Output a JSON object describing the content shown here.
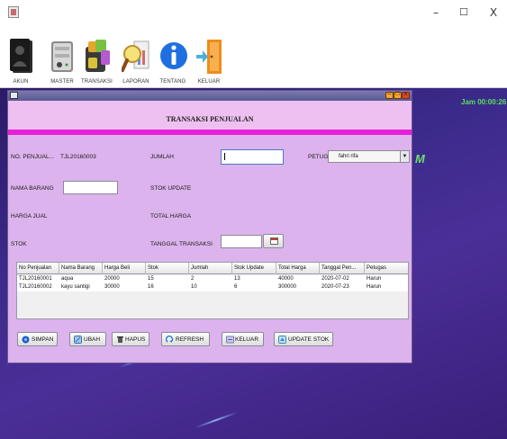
{
  "window": {
    "min_glyph": "–",
    "max_glyph": "☐",
    "close_glyph": "X"
  },
  "toolbar": [
    {
      "label": "AKUN",
      "icon": "user-card-icon"
    },
    {
      "label": "MASTER",
      "icon": "server-icon"
    },
    {
      "label": "TRANSAKSI",
      "icon": "transaction-icon"
    },
    {
      "label": "LAPORAN",
      "icon": "magnifier-report-icon"
    },
    {
      "label": "TENTANG",
      "icon": "info-icon"
    },
    {
      "label": "KELUAR",
      "icon": "exit-door-icon"
    }
  ],
  "desktop": {
    "clock": "Jam 00:00:26",
    "bg_letter": "M"
  },
  "form": {
    "title": "TRANSAKSI PENJUALAN",
    "no_penjualan_label": "NO. PENJUAL...",
    "no_penjualan_value": "TJL20160003",
    "jumlah_label": "JUMLAH",
    "jumlah_value": "",
    "petugas_label": "PETUGAS",
    "petugas_value": "fahri rifa",
    "nama_barang_label": "NAMA BARANG",
    "nama_barang_value": "",
    "stok_update_label": "STOK UPDATE",
    "harga_jual_label": "HARGA JUAL",
    "total_harga_label": "TOTAL HARGA",
    "stok_label": "STOK",
    "tanggal_label": "TANGGAL TRANSAKSI",
    "tanggal_value": ""
  },
  "table": {
    "headers": [
      "No Penjualan",
      "Nama Barang",
      "Harga Beli",
      "Stok",
      "Jumlah",
      "Stok Update",
      "Total Harga",
      "Tanggal Pen...",
      "Petugas"
    ],
    "rows": [
      [
        "TJL20160001",
        "aqua",
        "20000",
        "15",
        "2",
        "13",
        "40000",
        "2020-07-02",
        "Harun"
      ],
      [
        "TJL20160002",
        "kayu santigi",
        "30000",
        "16",
        "10",
        "6",
        "300000",
        "2020-07-23",
        "Harun"
      ]
    ]
  },
  "buttons": {
    "simpan": "SIMPAN",
    "ubah": "UBAH",
    "hapus": "HAPUS",
    "refresh": "REFRESH",
    "keluar": "KELUAR",
    "update_stok": "UPDATE STOK"
  },
  "colors": {
    "form_bg": "#dcb3ec",
    "header_band": "#eec0f2",
    "magenta_stripe": "#e81fd8",
    "desktop_bg": "#3b2a8a",
    "clock": "#57e35a"
  }
}
